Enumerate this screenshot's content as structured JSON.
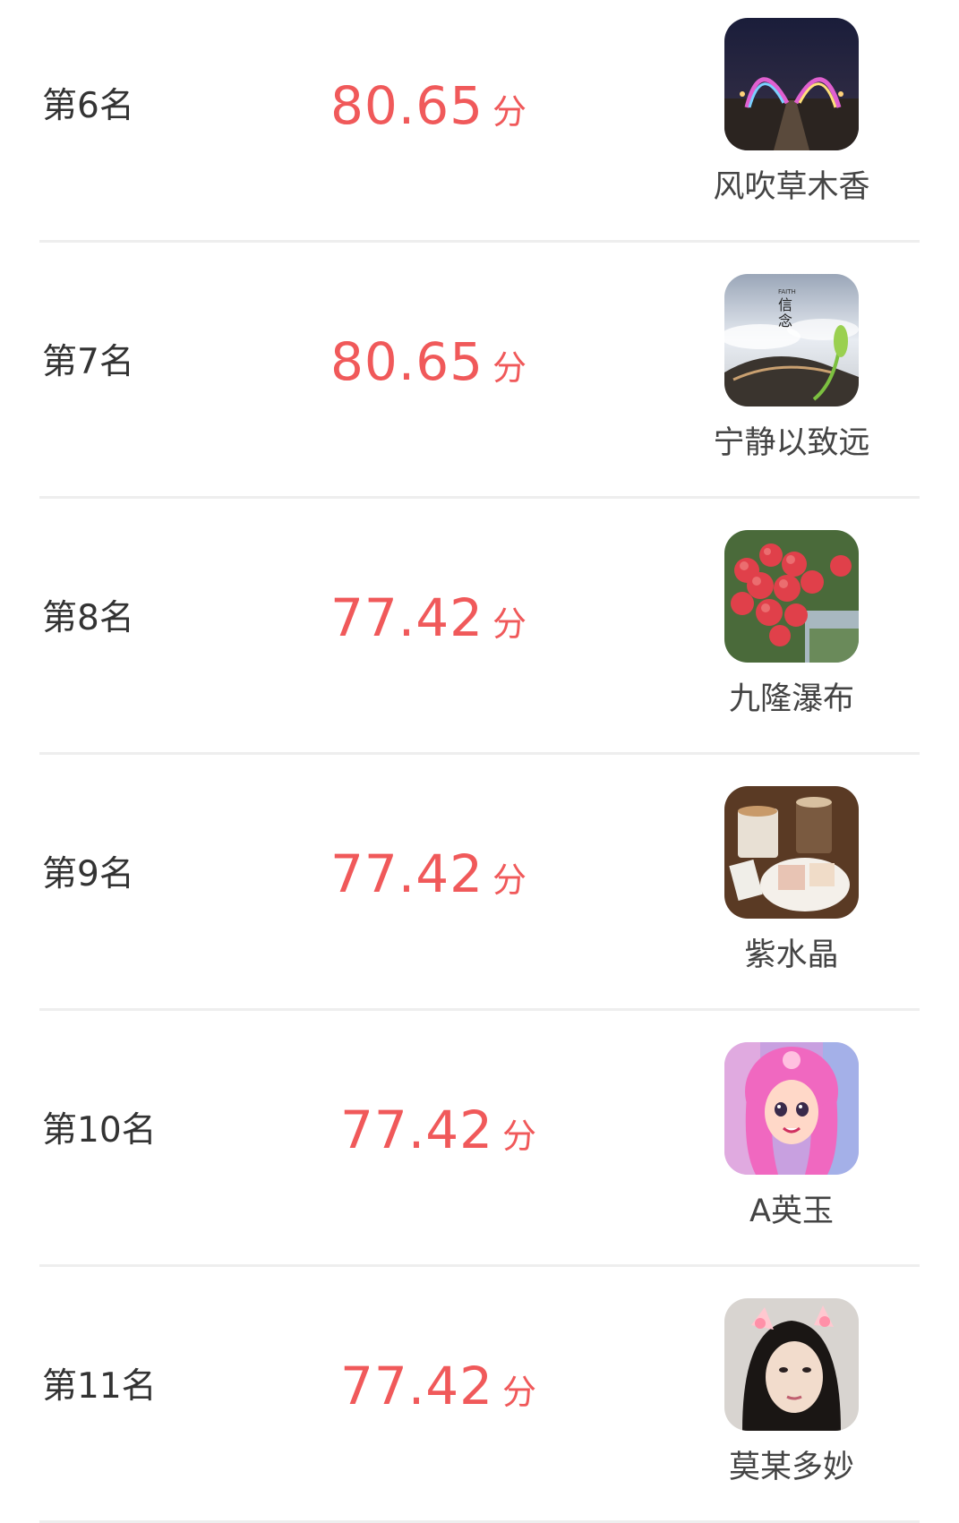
{
  "rows": [
    {
      "rank": "第6名",
      "score": "80.65",
      "unit": "分",
      "name": "风吹草木香",
      "avatar_icon": "night-bridge-avatar-icon"
    },
    {
      "rank": "第7名",
      "score": "80.65",
      "unit": "分",
      "name": "宁静以致远",
      "avatar_icon": "faith-clouds-avatar-icon",
      "avatar_text": "FAITH 信念"
    },
    {
      "rank": "第8名",
      "score": "77.42",
      "unit": "分",
      "name": "九隆瀑布",
      "avatar_icon": "lychee-avatar-icon"
    },
    {
      "rank": "第9名",
      "score": "77.42",
      "unit": "分",
      "name": "紫水晶",
      "avatar_icon": "coffee-cake-avatar-icon"
    },
    {
      "rank": "第10名",
      "score": "77.42",
      "unit": "分",
      "name": "A英玉",
      "avatar_icon": "cartoon-girl-avatar-icon"
    },
    {
      "rank": "第11名",
      "score": "77.42",
      "unit": "分",
      "name": "莫某多妙",
      "avatar_icon": "woman-selfie-avatar-icon"
    }
  ],
  "colors": {
    "score": "#f0595a",
    "rank_text": "#333333",
    "divider": "#eeeeee"
  }
}
